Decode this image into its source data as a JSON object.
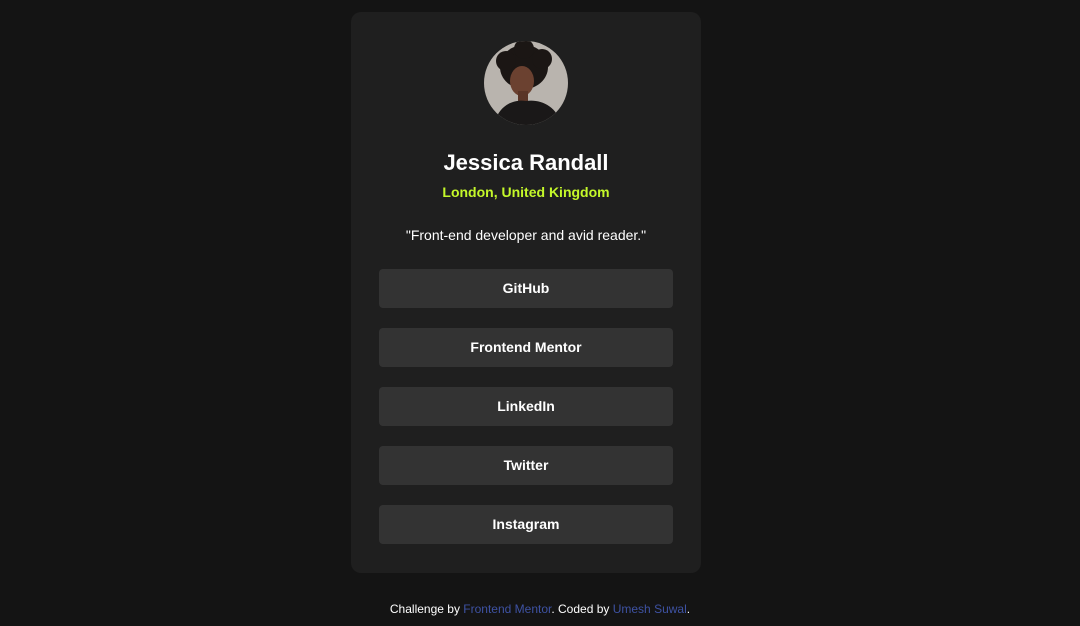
{
  "profile": {
    "avatar_icon": "profile-photo",
    "name": "Jessica Randall",
    "location": "London, United Kingdom",
    "bio": "\"Front-end developer and avid reader.\""
  },
  "links": [
    {
      "label": "GitHub"
    },
    {
      "label": "Frontend Mentor"
    },
    {
      "label": "LinkedIn"
    },
    {
      "label": "Twitter"
    },
    {
      "label": "Instagram"
    }
  ],
  "footer": {
    "prefix": "Challenge by ",
    "challenge_link": "Frontend Mentor",
    "middle": ". Coded by ",
    "author_link": "Umesh Suwal",
    "suffix": "."
  },
  "colors": {
    "background": "#141414",
    "card": "#1f1f1f",
    "button": "#333333",
    "accent": "#c4f82a",
    "footer_link": "#3e52a3"
  }
}
